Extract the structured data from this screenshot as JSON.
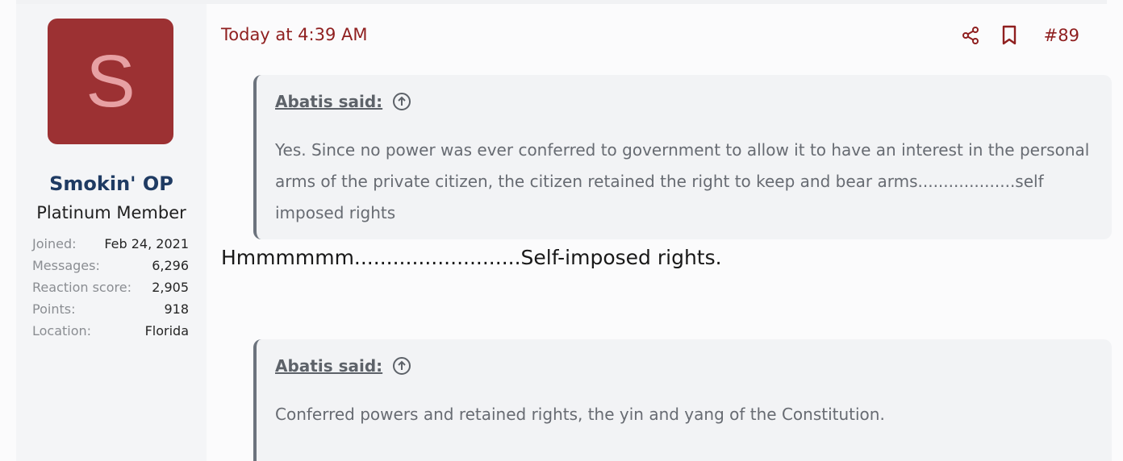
{
  "user": {
    "avatar_letter": "S",
    "name": "Smokin' OP",
    "title": "Platinum Member",
    "stats": [
      {
        "label": "Joined:",
        "value": "Feb 24, 2021"
      },
      {
        "label": "Messages:",
        "value": "6,296"
      },
      {
        "label": "Reaction score:",
        "value": "2,905"
      },
      {
        "label": "Points:",
        "value": "918"
      },
      {
        "label": "Location:",
        "value": "Florida"
      }
    ]
  },
  "post": {
    "date": "Today at 4:39 AM",
    "number": "#89",
    "body": "Hmmmmmm..........................Self-imposed rights.",
    "actions": [
      {
        "name": "share-icon"
      },
      {
        "name": "bookmark-icon"
      }
    ]
  },
  "quotes": [
    {
      "author": "Abatis said:",
      "text": "Yes. Since no power was ever conferred to government to allow it to have an interest in the personal arms of the private citizen, the citizen retained the right to keep and bear arms...................self imposed rights"
    },
    {
      "author": "Abatis said:",
      "text": "Conferred powers and retained rights, the yin and yang of the Constitution."
    }
  ],
  "colors": {
    "accent": "#8f1f1f",
    "avatar_bg": "#9c3133",
    "avatar_fg": "#e7a0a3",
    "username": "#1f3b63",
    "quote_bg": "#f2f3f5",
    "quote_border": "#6c737d"
  }
}
